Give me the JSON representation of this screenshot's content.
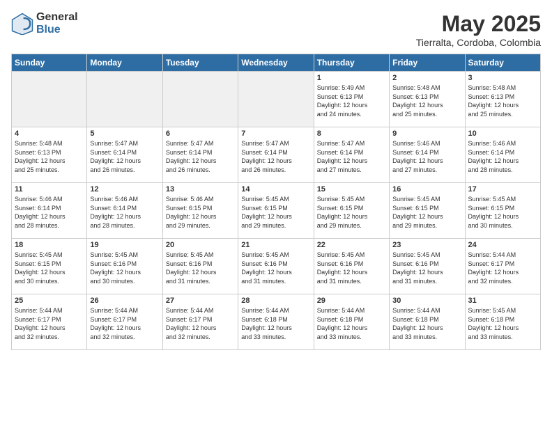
{
  "logo": {
    "general": "General",
    "blue": "Blue"
  },
  "title": {
    "month_year": "May 2025",
    "location": "Tierralta, Cordoba, Colombia"
  },
  "weekdays": [
    "Sunday",
    "Monday",
    "Tuesday",
    "Wednesday",
    "Thursday",
    "Friday",
    "Saturday"
  ],
  "weeks": [
    [
      {
        "day": "",
        "info": "",
        "empty": true
      },
      {
        "day": "",
        "info": "",
        "empty": true
      },
      {
        "day": "",
        "info": "",
        "empty": true
      },
      {
        "day": "",
        "info": "",
        "empty": true
      },
      {
        "day": "1",
        "info": "Sunrise: 5:49 AM\nSunset: 6:13 PM\nDaylight: 12 hours\nand 24 minutes."
      },
      {
        "day": "2",
        "info": "Sunrise: 5:48 AM\nSunset: 6:13 PM\nDaylight: 12 hours\nand 25 minutes."
      },
      {
        "day": "3",
        "info": "Sunrise: 5:48 AM\nSunset: 6:13 PM\nDaylight: 12 hours\nand 25 minutes."
      }
    ],
    [
      {
        "day": "4",
        "info": "Sunrise: 5:48 AM\nSunset: 6:13 PM\nDaylight: 12 hours\nand 25 minutes."
      },
      {
        "day": "5",
        "info": "Sunrise: 5:47 AM\nSunset: 6:14 PM\nDaylight: 12 hours\nand 26 minutes."
      },
      {
        "day": "6",
        "info": "Sunrise: 5:47 AM\nSunset: 6:14 PM\nDaylight: 12 hours\nand 26 minutes."
      },
      {
        "day": "7",
        "info": "Sunrise: 5:47 AM\nSunset: 6:14 PM\nDaylight: 12 hours\nand 26 minutes."
      },
      {
        "day": "8",
        "info": "Sunrise: 5:47 AM\nSunset: 6:14 PM\nDaylight: 12 hours\nand 27 minutes."
      },
      {
        "day": "9",
        "info": "Sunrise: 5:46 AM\nSunset: 6:14 PM\nDaylight: 12 hours\nand 27 minutes."
      },
      {
        "day": "10",
        "info": "Sunrise: 5:46 AM\nSunset: 6:14 PM\nDaylight: 12 hours\nand 28 minutes."
      }
    ],
    [
      {
        "day": "11",
        "info": "Sunrise: 5:46 AM\nSunset: 6:14 PM\nDaylight: 12 hours\nand 28 minutes."
      },
      {
        "day": "12",
        "info": "Sunrise: 5:46 AM\nSunset: 6:14 PM\nDaylight: 12 hours\nand 28 minutes."
      },
      {
        "day": "13",
        "info": "Sunrise: 5:46 AM\nSunset: 6:15 PM\nDaylight: 12 hours\nand 29 minutes."
      },
      {
        "day": "14",
        "info": "Sunrise: 5:45 AM\nSunset: 6:15 PM\nDaylight: 12 hours\nand 29 minutes."
      },
      {
        "day": "15",
        "info": "Sunrise: 5:45 AM\nSunset: 6:15 PM\nDaylight: 12 hours\nand 29 minutes."
      },
      {
        "day": "16",
        "info": "Sunrise: 5:45 AM\nSunset: 6:15 PM\nDaylight: 12 hours\nand 29 minutes."
      },
      {
        "day": "17",
        "info": "Sunrise: 5:45 AM\nSunset: 6:15 PM\nDaylight: 12 hours\nand 30 minutes."
      }
    ],
    [
      {
        "day": "18",
        "info": "Sunrise: 5:45 AM\nSunset: 6:15 PM\nDaylight: 12 hours\nand 30 minutes."
      },
      {
        "day": "19",
        "info": "Sunrise: 5:45 AM\nSunset: 6:16 PM\nDaylight: 12 hours\nand 30 minutes."
      },
      {
        "day": "20",
        "info": "Sunrise: 5:45 AM\nSunset: 6:16 PM\nDaylight: 12 hours\nand 31 minutes."
      },
      {
        "day": "21",
        "info": "Sunrise: 5:45 AM\nSunset: 6:16 PM\nDaylight: 12 hours\nand 31 minutes."
      },
      {
        "day": "22",
        "info": "Sunrise: 5:45 AM\nSunset: 6:16 PM\nDaylight: 12 hours\nand 31 minutes."
      },
      {
        "day": "23",
        "info": "Sunrise: 5:45 AM\nSunset: 6:16 PM\nDaylight: 12 hours\nand 31 minutes."
      },
      {
        "day": "24",
        "info": "Sunrise: 5:44 AM\nSunset: 6:17 PM\nDaylight: 12 hours\nand 32 minutes."
      }
    ],
    [
      {
        "day": "25",
        "info": "Sunrise: 5:44 AM\nSunset: 6:17 PM\nDaylight: 12 hours\nand 32 minutes."
      },
      {
        "day": "26",
        "info": "Sunrise: 5:44 AM\nSunset: 6:17 PM\nDaylight: 12 hours\nand 32 minutes."
      },
      {
        "day": "27",
        "info": "Sunrise: 5:44 AM\nSunset: 6:17 PM\nDaylight: 12 hours\nand 32 minutes."
      },
      {
        "day": "28",
        "info": "Sunrise: 5:44 AM\nSunset: 6:18 PM\nDaylight: 12 hours\nand 33 minutes."
      },
      {
        "day": "29",
        "info": "Sunrise: 5:44 AM\nSunset: 6:18 PM\nDaylight: 12 hours\nand 33 minutes."
      },
      {
        "day": "30",
        "info": "Sunrise: 5:44 AM\nSunset: 6:18 PM\nDaylight: 12 hours\nand 33 minutes."
      },
      {
        "day": "31",
        "info": "Sunrise: 5:45 AM\nSunset: 6:18 PM\nDaylight: 12 hours\nand 33 minutes."
      }
    ]
  ]
}
